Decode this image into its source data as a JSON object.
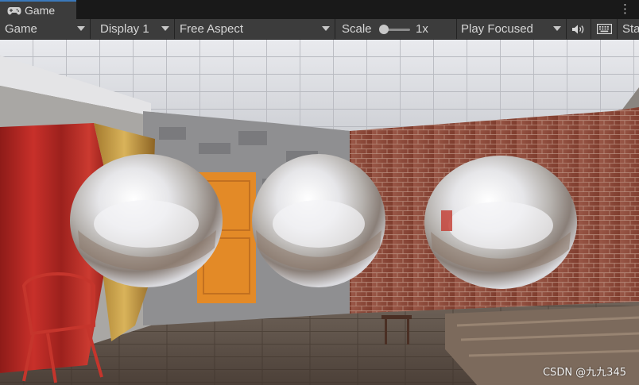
{
  "tab": {
    "title": "Game",
    "icon": "gamepad-icon"
  },
  "window_menu_icon": "kebab-menu-icon",
  "toolbar": {
    "mode": "Game",
    "display": "Display 1",
    "aspect": "Free Aspect",
    "scale_label": "Scale",
    "scale_value": "1x",
    "scale_fraction": 0.0,
    "play_mode": "Play Focused",
    "mute_icon": "speaker-icon",
    "stats_icon": "keyboard-icon",
    "stats_label": "Sta"
  },
  "viewport": {
    "watermark": "CSDN @九九345"
  },
  "colors": {
    "toolbar_bg": "#3c3c3c",
    "tab_accent": "#3a79bb",
    "brick_wall": "#8c4634",
    "door": "#e18a2a",
    "curtain": "#b3231f"
  }
}
